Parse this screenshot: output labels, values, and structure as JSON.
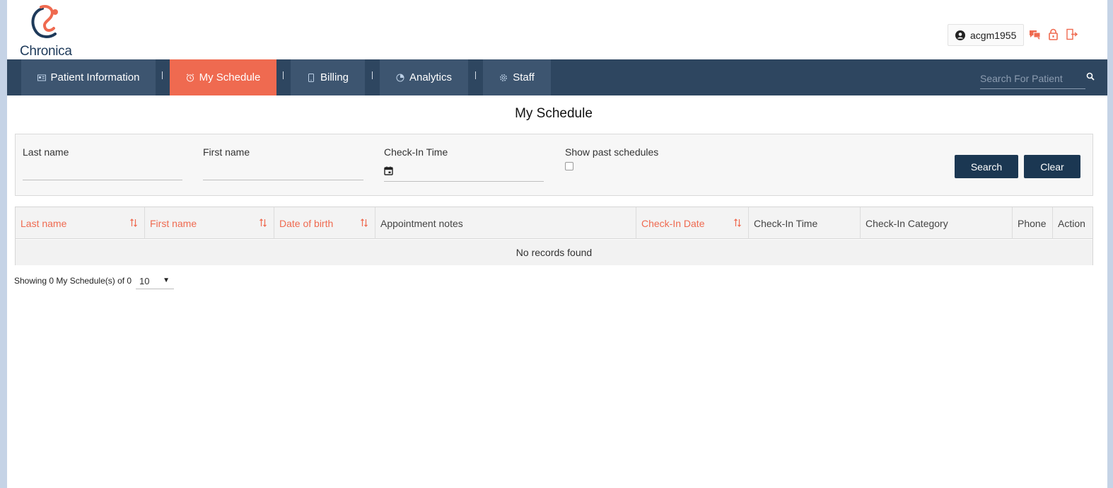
{
  "header": {
    "brand": "Chronica",
    "username": "acgm1955",
    "icons": [
      "chat-icon",
      "lock-icon",
      "logout-icon"
    ]
  },
  "nav": {
    "items": [
      {
        "label": "Patient Information",
        "icon": "id-card-icon"
      },
      {
        "label": "My Schedule",
        "icon": "alarm-clock-icon"
      },
      {
        "label": "Billing",
        "icon": "tablet-icon"
      },
      {
        "label": "Analytics",
        "icon": "pie-chart-icon"
      },
      {
        "label": "Staff",
        "icon": "gear-icon"
      }
    ],
    "active": "My Schedule",
    "search_placeholder": "Search For Patient"
  },
  "page": {
    "title": "My Schedule"
  },
  "filters": {
    "last_name_label": "Last name",
    "first_name_label": "First name",
    "checkin_time_label": "Check-In Time",
    "show_past_label": "Show past schedules",
    "search_button": "Search",
    "clear_button": "Clear"
  },
  "table": {
    "columns": [
      {
        "label": "Last name",
        "sortable": true
      },
      {
        "label": "First name",
        "sortable": true
      },
      {
        "label": "Date of birth",
        "sortable": true
      },
      {
        "label": "Appointment notes",
        "sortable": false
      },
      {
        "label": "Check-In Date",
        "sortable": true
      },
      {
        "label": "Check-In Time",
        "sortable": false
      },
      {
        "label": "Check-In Category",
        "sortable": false
      },
      {
        "label": "Phone",
        "sortable": false
      },
      {
        "label": "Action",
        "sortable": false
      }
    ],
    "empty_message": "No records found"
  },
  "pagination": {
    "summary": "Showing 0 My Schedule(s) of 0",
    "page_size": "10"
  },
  "colors": {
    "accent": "#ef6a50",
    "navbar": "#2e4660",
    "nav_item": "#3d5570",
    "button": "#1b3752"
  }
}
